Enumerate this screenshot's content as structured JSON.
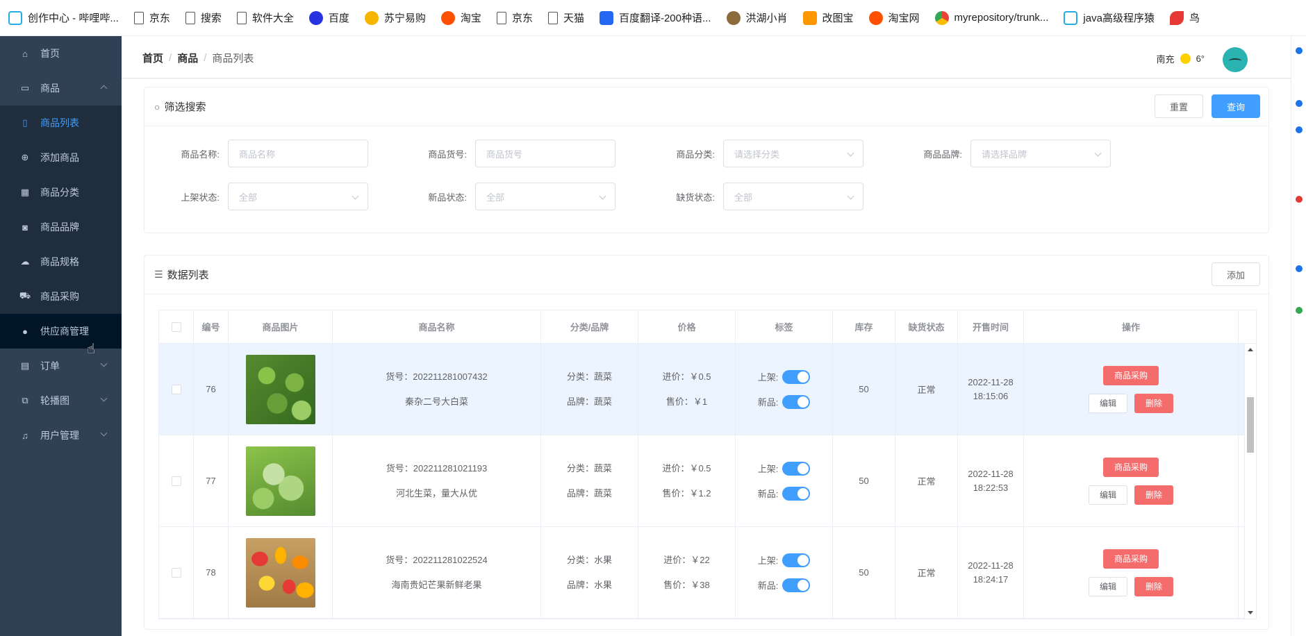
{
  "bookmarks": [
    {
      "icon": "bili",
      "label": "创作中心 - 哔哩哔..."
    },
    {
      "icon": "doc",
      "label": "京东"
    },
    {
      "icon": "doc",
      "label": "搜索"
    },
    {
      "icon": "doc",
      "label": "软件大全"
    },
    {
      "icon": "baidu",
      "label": "百度"
    },
    {
      "icon": "suning",
      "label": "苏宁易购"
    },
    {
      "icon": "tao",
      "label": "淘宝"
    },
    {
      "icon": "doc",
      "label": "京东"
    },
    {
      "icon": "doc",
      "label": "天猫"
    },
    {
      "icon": "fanyi",
      "label": "百度翻译-200种语..."
    },
    {
      "icon": "hong",
      "label": "洪湖小肖"
    },
    {
      "icon": "gai",
      "label": "改图宝"
    },
    {
      "icon": "tao",
      "label": "淘宝网"
    },
    {
      "icon": "chrome",
      "label": "myrepository/trunk..."
    },
    {
      "icon": "bili",
      "label": "java高级程序猿"
    },
    {
      "icon": "bird",
      "label": "鸟"
    }
  ],
  "sidebar": {
    "items": [
      {
        "label": "首页",
        "icon": "home-icon",
        "glyph": "⌂"
      },
      {
        "label": "商品",
        "icon": "product-icon",
        "glyph": "▭",
        "expanded": true
      },
      {
        "label": "订单",
        "icon": "order-icon",
        "glyph": "▤"
      },
      {
        "label": "轮播图",
        "icon": "carousel-icon",
        "glyph": "⧉"
      },
      {
        "label": "用户管理",
        "icon": "bell-icon",
        "glyph": "♫"
      }
    ],
    "submenu": [
      {
        "label": "商品列表",
        "icon": "trash-icon",
        "glyph": "🗑",
        "active": true
      },
      {
        "label": "添加商品",
        "icon": "plus-circle-icon",
        "glyph": "⊕"
      },
      {
        "label": "商品分类",
        "icon": "grid-icon",
        "glyph": "▦"
      },
      {
        "label": "商品品牌",
        "icon": "brand-icon",
        "glyph": "◙"
      },
      {
        "label": "商品规格",
        "icon": "cloud-icon",
        "glyph": "☁"
      },
      {
        "label": "商品采购",
        "icon": "truck-icon",
        "glyph": "⛟"
      },
      {
        "label": "供应商管理",
        "icon": "user-icon",
        "glyph": "👤"
      }
    ]
  },
  "header": {
    "breadcrumb": [
      "首页",
      "商品",
      "商品列表"
    ],
    "city": "南充",
    "temp": "6°"
  },
  "filter": {
    "title": "筛选搜索",
    "reset": "重置",
    "query": "查询",
    "fields": {
      "name_label": "商品名称:",
      "name_ph": "商品名称",
      "sn_label": "商品货号:",
      "sn_ph": "商品货号",
      "cat_label": "商品分类:",
      "cat_ph": "请选择分类",
      "brand_label": "商品品牌:",
      "brand_ph": "请选择品牌",
      "pub_label": "上架状态:",
      "pub_val": "全部",
      "new_label": "新品状态:",
      "new_val": "全部",
      "stock_label": "缺货状态:",
      "stock_val": "全部"
    }
  },
  "list": {
    "title": "数据列表",
    "add": "添加",
    "columns": [
      "编号",
      "商品图片",
      "商品名称",
      "分类/品牌",
      "价格",
      "标签",
      "库存",
      "缺货状态",
      "开售时间",
      "操作"
    ],
    "rows": [
      {
        "id": "76",
        "img": "cabbage",
        "sn": "货号：202211281007432",
        "name": "秦杂二号大白菜",
        "cat": "分类：蔬菜",
        "brand": "品牌：蔬菜",
        "cost": "进价：￥0.5",
        "price": "售价：￥1",
        "pub": "上架:",
        "new": "新品:",
        "stock": "50",
        "status": "正常",
        "date": "2022-11-28",
        "time": "18:15:06",
        "highlight": true
      },
      {
        "id": "77",
        "img": "lettuce",
        "sn": "货号：202211281021193",
        "name": "河北生菜，量大从优",
        "cat": "分类：蔬菜",
        "brand": "品牌：蔬菜",
        "cost": "进价：￥0.5",
        "price": "售价：￥1.2",
        "pub": "上架:",
        "new": "新品:",
        "stock": "50",
        "status": "正常",
        "date": "2022-11-28",
        "time": "18:22:53",
        "highlight": false
      },
      {
        "id": "78",
        "img": "mango",
        "sn": "货号：202211281022524",
        "name": "海南贵妃芒果新鲜老果",
        "cat": "分类：水果",
        "brand": "品牌：水果",
        "cost": "进价：￥22",
        "price": "售价：￥38",
        "pub": "上架:",
        "new": "新品:",
        "stock": "50",
        "status": "正常",
        "date": "2022-11-28",
        "time": "18:24:17",
        "highlight": false
      }
    ],
    "ops": {
      "purchase": "商品采购",
      "edit": "编辑",
      "delete": "删除"
    }
  }
}
